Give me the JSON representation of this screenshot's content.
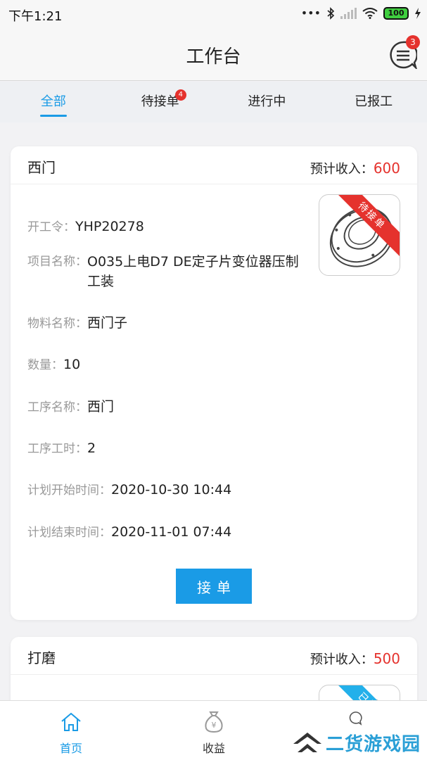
{
  "status_bar": {
    "time": "下午1:21",
    "dots": "•••",
    "battery": "100"
  },
  "header": {
    "title": "工作台",
    "message_badge": "3"
  },
  "tabs": [
    {
      "label": "全部",
      "active": true
    },
    {
      "label": "待接单",
      "badge": "4"
    },
    {
      "label": "进行中"
    },
    {
      "label": "已报工"
    }
  ],
  "cards": [
    {
      "name": "西门",
      "income_label": "预计收入：",
      "income_value": "600",
      "ribbon": "待接单",
      "fields": {
        "order_label": "开工令：",
        "order_value": "YHP20278",
        "project_label": "项目名称：",
        "project_value": "O035上电D7 DE定子片变位器压制工装",
        "material_label": "物料名称：",
        "material_value": "西门子",
        "qty_label": "数量：",
        "qty_value": "10",
        "process_label": "工序名称：",
        "process_value": "西门",
        "hours_label": "工序工时：",
        "hours_value": "2",
        "start_label": "计划开始时间：",
        "start_value": "2020-10-30 10:44",
        "end_label": "计划结束时间：",
        "end_value": "2020-11-01 07:44"
      },
      "button": "接单"
    },
    {
      "name": "打磨",
      "income_label": "预计收入：",
      "income_value": "500",
      "ribbon": "已接单"
    }
  ],
  "bottom_nav": [
    {
      "label": "首页",
      "icon": "home-icon",
      "active": true
    },
    {
      "label": "收益",
      "icon": "money-bag-icon"
    },
    {
      "label": "",
      "icon": "chat-icon"
    }
  ],
  "watermark": "二货游戏园",
  "colors": {
    "accent": "#1a9be6",
    "badge": "#e5322d",
    "income": "#e5322d"
  }
}
